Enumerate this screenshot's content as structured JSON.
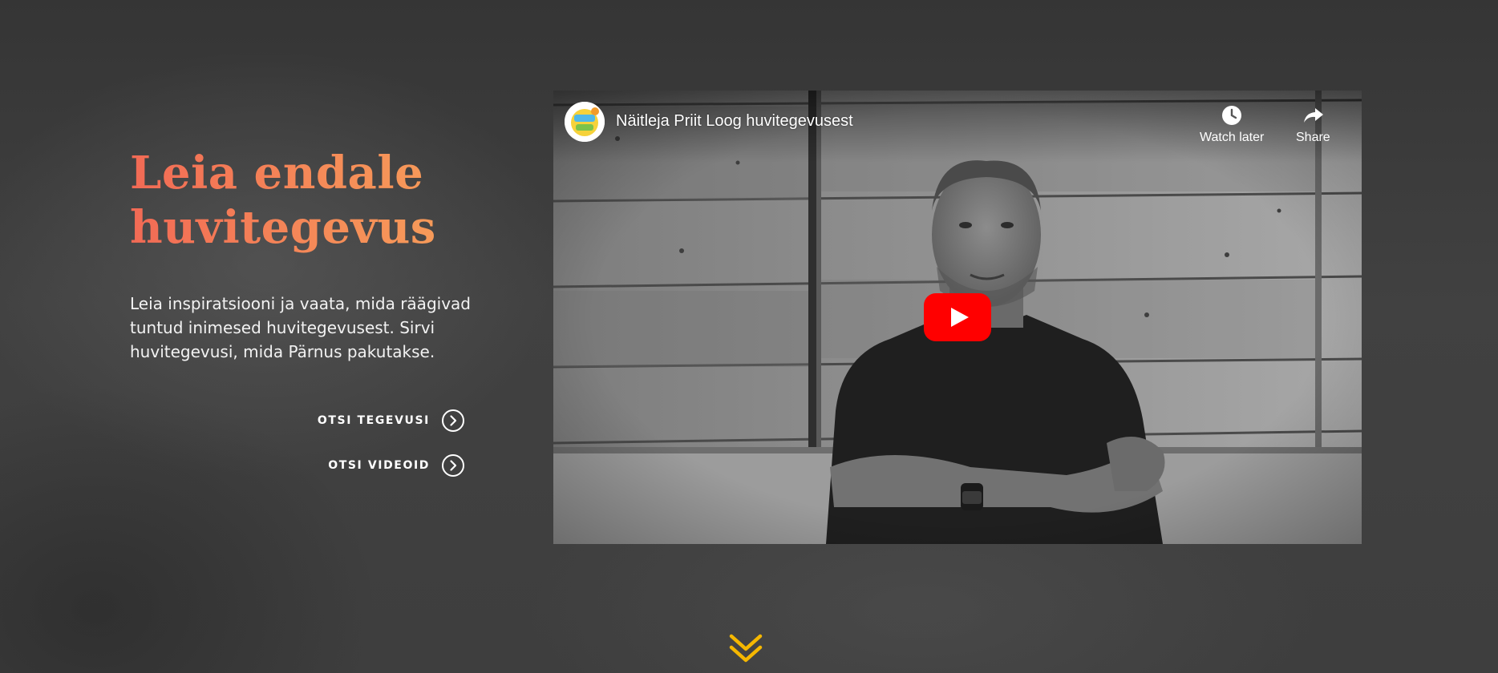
{
  "hero": {
    "title_line1": "Leia endale",
    "title_line2": "huvitegevus",
    "description": "Leia inspiratsiooni ja vaata, mida räägivad tuntud inimesed huvitegevusest. Sirvi huvitegevusi, mida Pärnus pakutakse.",
    "accent_colors": [
      "#f26a55",
      "#f7a95a"
    ]
  },
  "actions": {
    "search_activities": "OTSI TEGEVUSI",
    "search_videos": "OTSI VIDEOID"
  },
  "video": {
    "title": "Näitleja Priit Loog huvitegevusest",
    "watch_later": "Watch later",
    "share": "Share",
    "play_icon": "youtube-play-icon",
    "play_color": "#ff0000"
  },
  "scroll": {
    "icon": "double-chevron-down-icon",
    "color": "#f5b700"
  }
}
